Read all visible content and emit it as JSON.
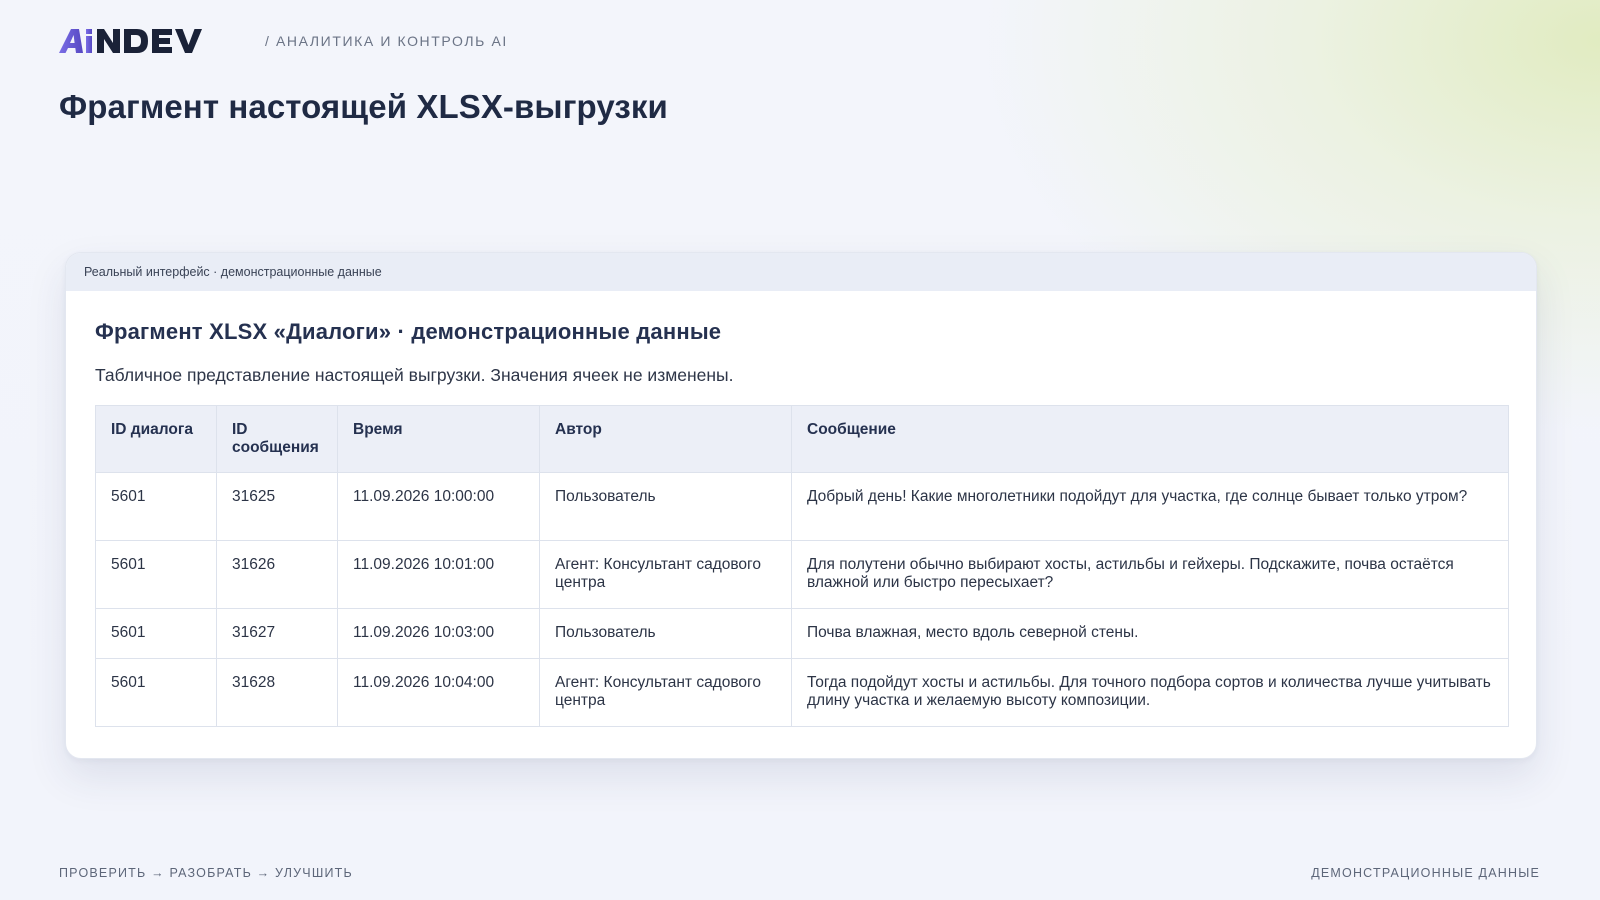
{
  "header": {
    "logo_text": "AiNDEV",
    "subtitle": "/ АНАЛИТИКА И КОНТРОЛЬ AI"
  },
  "page": {
    "title": "Фрагмент настоящей XLSX-выгрузки"
  },
  "card": {
    "bar_label": "Реальный интерфейс · демонстрационные данные",
    "title": "Фрагмент XLSX «Диалоги» · демонстрационные данные",
    "description": "Табличное представление настоящей выгрузки. Значения ячеек не изменены."
  },
  "table": {
    "columns": [
      "ID диалога",
      "ID сообщения",
      "Время",
      "Автор",
      "Сообщение"
    ],
    "rows": [
      [
        "5601",
        "31625",
        "11.09.2026 10:00:00",
        "Пользователь",
        "Добрый день! Какие многолетники подойдут для участка, где солнце бывает только утром?"
      ],
      [
        "5601",
        "31626",
        "11.09.2026 10:01:00",
        "Агент: Консультант садового центра",
        "Для полутени обычно выбирают хосты, астильбы и гейхеры. Подскажите, почва остаётся влажной или быстро пересыхает?"
      ],
      [
        "5601",
        "31627",
        "11.09.2026 10:03:00",
        "Пользователь",
        "Почва влажная, место вдоль северной стены."
      ],
      [
        "5601",
        "31628",
        "11.09.2026 10:04:00",
        "Агент: Консультант садового центра",
        "Тогда подойдут хосты и астильбы. Для точного подбора сортов и количества лучше учитывать длину участка и желаемую высоту композиции."
      ]
    ]
  },
  "footer": {
    "left": "ПРОВЕРИТЬ → РАЗОБРАТЬ → УЛУЧШИТЬ",
    "right": "ДЕМОНСТРАЦИОННЫЕ ДАННЫЕ"
  },
  "colors": {
    "logo_accent": "#6a5fd6",
    "logo_dark": "#1a2238",
    "text_primary": "#1f2a44",
    "header_bg": "#eceff7"
  }
}
